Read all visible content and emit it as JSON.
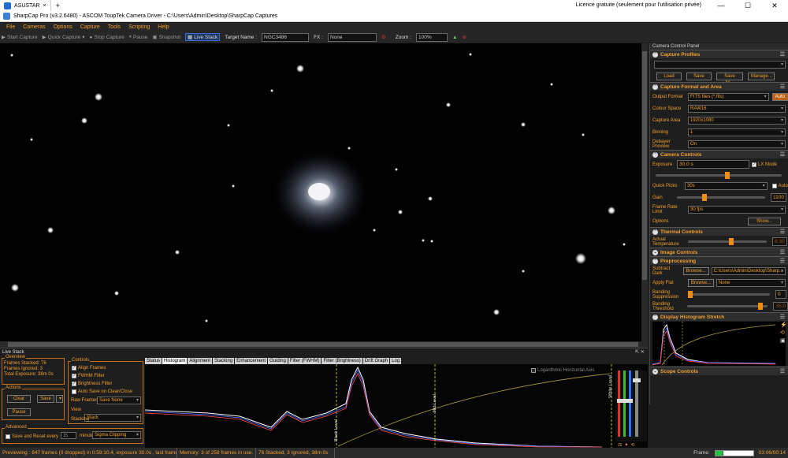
{
  "browser": {
    "tab": "ASUSTAR",
    "close": "×",
    "newtab": "+",
    "licence": "Licence gratuite (seulement pour l'utilisation privée)"
  },
  "app": {
    "title": "SharpCap Pro (v3.2.6480) - ASCOM ToupTek Camera Driver - C:\\Users\\Admin\\Desktop\\SharpCap Captures"
  },
  "menu": [
    "File",
    "Cameras",
    "Options",
    "Capture",
    "Tools",
    "Scripting",
    "Help"
  ],
  "toolbar": {
    "start": "Start Capture",
    "quick": "Quick Capture",
    "stop": "Stop Capture",
    "pause": "Pause",
    "snapshot": "Snapshot",
    "live": "Live Stack",
    "target_label": "Target Name :",
    "target": "NGC3486",
    "fx_label": "FX :",
    "fx": "None",
    "zoom_label": "Zoom :",
    "zoom": "100%"
  },
  "panel": {
    "title": "Camera Control Panel",
    "profiles": {
      "title": "Capture Profiles",
      "load": "Load",
      "save": "Save",
      "saveas": "Save As...",
      "manage": "Manage..."
    },
    "format": {
      "title": "Capture Format and Area",
      "output_label": "Output Format",
      "output": "FITS files (*.fits)",
      "auto": "Auto",
      "colour_label": "Colour Space",
      "colour": "RAW16",
      "area_label": "Capture Area",
      "area": "1920x1080",
      "binning_label": "Binning",
      "binning": "1",
      "debayer_label": "Debayer Preview",
      "debayer": "On"
    },
    "camera": {
      "title": "Camera Controls",
      "exposure_label": "Exposure",
      "exposure": "30.0 s",
      "lx": "LX Mode",
      "quick_label": "Quick Picks",
      "quick": "30s",
      "auto": "Auto",
      "gain_label": "Gain",
      "gain": "1100",
      "fps_label": "Frame Rate Limit",
      "fps": "30 fps",
      "options_label": "Options",
      "show": "Show..."
    },
    "thermal": {
      "title": "Thermal Controls",
      "temp_label": "Actual Temperature",
      "temp": "8.30"
    },
    "image": {
      "title": "Image Controls"
    },
    "pre": {
      "title": "Preprocessing",
      "dark_label": "Subtract Dark",
      "browse": "Browse...",
      "dark": "C:\\Users\\Admin\\Desktop\\Sharp...",
      "flat_label": "Apply Flat",
      "flat": "None",
      "band_label": "Banding Suppression",
      "band": "0",
      "thresh_label": "Banding Threshold",
      "thresh": "35.0"
    },
    "histo": {
      "title": "Display Histogram Stretch"
    },
    "scope": {
      "title": "Scope Controls"
    }
  },
  "livestack": {
    "title": "Live Stack",
    "overview": "Overview",
    "stacked": "Frames Stacked: 76",
    "ignored": "Frames Ignored: 3",
    "total": "Total Exposure: 38m 0s",
    "actions": "Actions",
    "clear": "Clear",
    "save": "Save",
    "pause": "Pause",
    "advanced": "Advanced",
    "reset": "Save and Reset every",
    "minutes": "15",
    "minutes_suffix": "minutes total exposure",
    "controls": "Controls",
    "align": "Align Frames",
    "fwhm": "FWHM Filter",
    "bright": "Brightness Filter",
    "autosave": "Auto Save on Clear/Close",
    "raw_label": "Raw Frames",
    "raw": "Save None",
    "view_label": "View",
    "view": "Stack",
    "stacking_label": "Stacking",
    "stacking": "Sigma Clipping",
    "tabs": [
      "Status",
      "Histogram",
      "Alignment",
      "Stacking",
      "Enhancement",
      "Guiding",
      "Filter (FWHM)",
      "Filter (Brightness)",
      "Drift Graph",
      "Log"
    ],
    "log": "Logarithmic Horizontal Axis",
    "black": "Black Level",
    "mid": "Mid Level",
    "white": "White Level"
  },
  "status": {
    "preview": "Previewing : 847 frames (0 dropped) in 0:59:10.4, exposure 30.0s , last frame 30.4s",
    "memory": "Memory: 3 of 258 frames in use.",
    "stacked": "76 Stacked, 3 Ignored, 38m 0s",
    "frame_label": "Frame:",
    "time": "03:06/00:14"
  },
  "colors": {
    "accent": "#f0a030"
  }
}
